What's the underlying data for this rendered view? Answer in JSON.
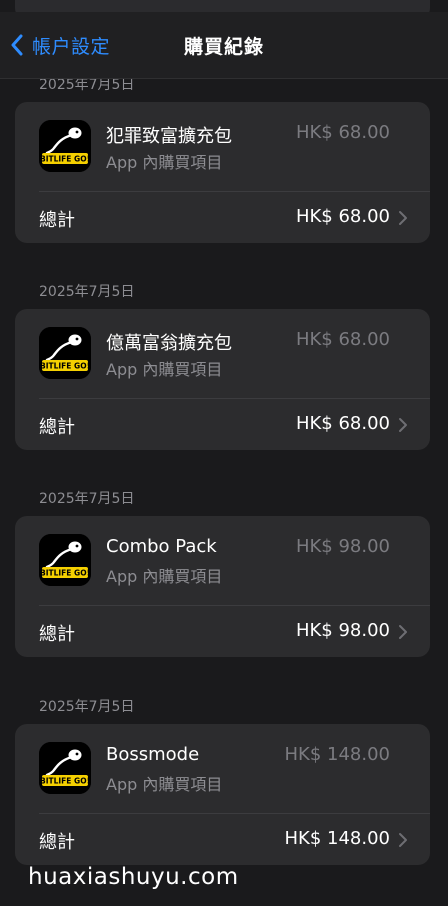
{
  "navbar": {
    "back_label": "帳户設定",
    "title": "購買紀錄"
  },
  "purchases": [
    {
      "date": "2025年7月5日",
      "app_icon": "bitlife-go-icon",
      "name": "犯罪致富擴充包",
      "subtitle": "App 內購買項目",
      "price": "HK$ 68.00",
      "total_label": "總計",
      "total_price": "HK$ 68.00"
    },
    {
      "date": "2025年7月5日",
      "app_icon": "bitlife-go-icon",
      "name": "億萬富翁擴充包",
      "subtitle": "App 內購買項目",
      "price": "HK$ 68.00",
      "total_label": "總計",
      "total_price": "HK$ 68.00"
    },
    {
      "date": "2025年7月5日",
      "app_icon": "bitlife-go-icon",
      "name": "Combo Pack",
      "subtitle": "App 內購買項目",
      "price": "HK$ 98.00",
      "total_label": "總計",
      "total_price": "HK$ 98.00"
    },
    {
      "date": "2025年7月5日",
      "app_icon": "bitlife-go-icon",
      "name": "Bossmode",
      "subtitle": "App 內購買項目",
      "price": "HK$ 148.00",
      "total_label": "總計",
      "total_price": "HK$ 148.00"
    }
  ],
  "watermark": "huaxiashuyu.com",
  "colors": {
    "background": "#1a1a1c",
    "card": "#2c2c2e",
    "accent": "#2e8cff",
    "secondary_text": "#8d8d92",
    "icon_badge": "#f5d000"
  }
}
